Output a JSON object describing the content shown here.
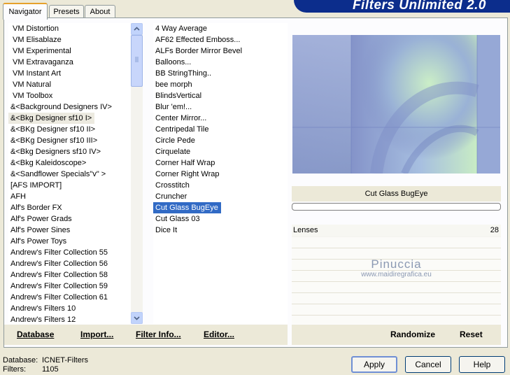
{
  "tabs": [
    {
      "label": "Navigator"
    },
    {
      "label": "Presets"
    },
    {
      "label": "About"
    }
  ],
  "banner_title": "Filters Unlimited 2.0",
  "categories": [
    "VM Distortion",
    "VM Elisablaze",
    "VM Experimental",
    "VM Extravaganza",
    "VM Instant Art",
    "VM Natural",
    "VM Toolbox",
    "&<Background Designers IV>",
    "&<Bkg Designer sf10 I>",
    "&<BKg Designer sf10 II>",
    "&<BKg Designer sf10 III>",
    "&<Bkg Designers sf10 IV>",
    "&<Bkg Kaleidoscope>",
    "&<Sandflower Specials\"v\" >",
    "[AFS IMPORT]",
    "AFH",
    "Alf's Border FX",
    "Alf's Power Grads",
    "Alf's Power Sines",
    "Alf's Power Toys",
    "Andrew's Filter Collection 55",
    "Andrew's Filter Collection 56",
    "Andrew's Filter Collection 58",
    "Andrew's Filter Collection 59",
    "Andrew's Filter Collection 61",
    "Andrew's Filters 10",
    "Andrew's Filters 12"
  ],
  "selected_category": "&<Bkg Designer sf10 I>",
  "filters": [
    "4 Way Average",
    "AF62 Effected Emboss...",
    "ALFs Border Mirror Bevel",
    "Balloons...",
    "BB StringThing..",
    "bee morph",
    "BlindsVertical",
    "Blur 'em!...",
    "Center Mirror...",
    "Centripedal Tile",
    "Circle Pede",
    "Cirquelate",
    "Corner Half Wrap",
    "Corner Right Wrap",
    "Crosstitch",
    "Cruncher",
    "Cut Glass  BugEye",
    "Cut Glass 03",
    "Dice It"
  ],
  "selected_filter": "Cut Glass  BugEye",
  "preview": {
    "filter_name": "Cut Glass  BugEye"
  },
  "params": [
    {
      "label": "Lenses",
      "value": "28"
    }
  ],
  "watermark": {
    "name": "Pinuccia",
    "url": "www.maidiregrafica.eu"
  },
  "left_buttons": [
    {
      "label": "Database"
    },
    {
      "label": "Import..."
    },
    {
      "label": "Filter Info..."
    },
    {
      "label": "Editor..."
    }
  ],
  "right_buttons": [
    {
      "label": "Randomize"
    },
    {
      "label": "Reset"
    }
  ],
  "status": {
    "database_label": "Database:",
    "database_value": "ICNET-Filters",
    "filters_label": "Filters:",
    "filters_value": "1105"
  },
  "dialog_buttons": {
    "apply": "Apply",
    "cancel": "Cancel",
    "help": "Help"
  },
  "colors": {
    "selection": "#316ac5",
    "banner": "#0c2d8c",
    "tab_accent": "#e6a12b"
  }
}
